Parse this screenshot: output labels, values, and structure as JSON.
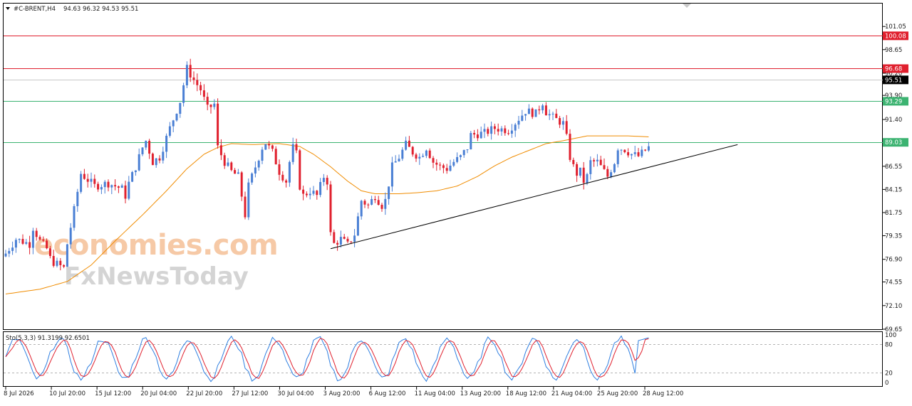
{
  "header": {
    "symbol": "#C-BRENT,H4",
    "ohlc": "94.63 96.32 94.53 95.51",
    "menu_icon": "triangle-down-icon"
  },
  "watermark": {
    "line1": "economies.com",
    "line2": "FxNewsToday"
  },
  "oscillator": {
    "label": "Sto(5,3,3) 91.3199 92.6501",
    "scale": [
      "100",
      "80",
      "20",
      "0"
    ]
  },
  "chart_data": {
    "type": "candlestick",
    "ylim": [
      69.65,
      103.5
    ],
    "y_ticks": [
      "101.05",
      "98.65",
      "96.20",
      "93.90",
      "91.40",
      "89.05",
      "86.55",
      "84.15",
      "81.75",
      "79.35",
      "76.90",
      "74.55",
      "72.10",
      "69.65"
    ],
    "x_tick_labels": [
      "8 Jul 2026",
      "10 Jul 20:00",
      "15 Jul 12:00",
      "20 Jul 04:00",
      "22 Jul 20:00",
      "27 Jul 12:00",
      "30 Jul 04:00",
      "3 Aug 20:00",
      "6 Aug 12:00",
      "11 Aug 04:00",
      "13 Aug 20:00",
      "18 Aug 12:00",
      "21 Aug 04:00",
      "25 Aug 20:00",
      "28 Aug 12:00"
    ],
    "bars": 189,
    "levels": [
      {
        "value": 100.08,
        "label": "100.08",
        "color": "#e0202e"
      },
      {
        "value": 96.68,
        "label": "96.68",
        "color": "#e0202e"
      },
      {
        "value": 95.51,
        "label": "95.51",
        "color": "#000000"
      },
      {
        "value": 93.29,
        "label": "93.29",
        "color": "#3cb371"
      },
      {
        "value": 89.03,
        "label": "89.03",
        "color": "#3cb371"
      }
    ],
    "trendline": {
      "from": {
        "bar": 95,
        "price": 78.0
      },
      "to": {
        "bar": 214,
        "price": 88.8
      }
    },
    "bull_color": "#4a7fd4",
    "bear_color": "#e0202e",
    "ma_color": "#f08c00",
    "close_path": [
      [
        0,
        77.5
      ],
      [
        3,
        79.0
      ],
      [
        7,
        78.5
      ],
      [
        8,
        80.2
      ],
      [
        10,
        78.8
      ],
      [
        12,
        78.0
      ],
      [
        13,
        77.0
      ],
      [
        14,
        76.6
      ],
      [
        17,
        76.0
      ],
      [
        18,
        78.5
      ],
      [
        20,
        82.0
      ],
      [
        22,
        85.8
      ],
      [
        26,
        84.5
      ],
      [
        30,
        84.8
      ],
      [
        34,
        84.2
      ],
      [
        35,
        83.5
      ],
      [
        36,
        84.8
      ],
      [
        38,
        86.5
      ],
      [
        40,
        88.5
      ],
      [
        41,
        89.2
      ],
      [
        43,
        87.0
      ],
      [
        45,
        87.5
      ],
      [
        48,
        90.5
      ],
      [
        51,
        93.3
      ],
      [
        53,
        96.7
      ],
      [
        55,
        95.5
      ],
      [
        57,
        94.5
      ],
      [
        59,
        92.5
      ],
      [
        61,
        93.0
      ],
      [
        62,
        88.5
      ],
      [
        64,
        87.0
      ],
      [
        66,
        86.0
      ],
      [
        68,
        85.5
      ],
      [
        70,
        81.5
      ],
      [
        71,
        84.5
      ],
      [
        73,
        86.5
      ],
      [
        75,
        88.5
      ],
      [
        76,
        89.0
      ],
      [
        78,
        88.0
      ],
      [
        80,
        86.0
      ],
      [
        82,
        85.0
      ],
      [
        83,
        87.0
      ],
      [
        84,
        88.5
      ],
      [
        85,
        87.8
      ],
      [
        86,
        84.5
      ],
      [
        87,
        83.5
      ],
      [
        89,
        84.0
      ],
      [
        91,
        83.5
      ],
      [
        93,
        85.5
      ],
      [
        94,
        85.0
      ],
      [
        95,
        79.5
      ],
      [
        96,
        78.5
      ],
      [
        98,
        79.0
      ],
      [
        100,
        78.4
      ],
      [
        102,
        79.5
      ],
      [
        104,
        83.0
      ],
      [
        106,
        82.5
      ],
      [
        108,
        83.5
      ],
      [
        110,
        82.5
      ],
      [
        111,
        83.0
      ],
      [
        113,
        86.5
      ],
      [
        115,
        87.5
      ],
      [
        117,
        88.8
      ],
      [
        119,
        88.0
      ],
      [
        121,
        87.5
      ],
      [
        123,
        88.5
      ],
      [
        125,
        87.0
      ],
      [
        127,
        86.5
      ],
      [
        129,
        86.3
      ],
      [
        131,
        87.0
      ],
      [
        133,
        87.5
      ],
      [
        135,
        88.5
      ],
      [
        136,
        89.8
      ],
      [
        140,
        90.0
      ],
      [
        143,
        90.5
      ],
      [
        147,
        90.3
      ],
      [
        150,
        91.5
      ],
      [
        152,
        92.3
      ],
      [
        155,
        92.0
      ],
      [
        157,
        93.2
      ],
      [
        158,
        92.2
      ],
      [
        160,
        91.6
      ],
      [
        163,
        91.0
      ],
      [
        164,
        89.5
      ],
      [
        165,
        87.5
      ],
      [
        166,
        86.5
      ],
      [
        167,
        85.8
      ],
      [
        168,
        86.0
      ],
      [
        169,
        85.0
      ],
      [
        170,
        85.5
      ],
      [
        171,
        87.0
      ],
      [
        173,
        87.0
      ],
      [
        175,
        86.0
      ],
      [
        176,
        85.5
      ],
      [
        178,
        87.0
      ],
      [
        179,
        88.5
      ],
      [
        181,
        88.3
      ],
      [
        183,
        87.8
      ],
      [
        185,
        87.6
      ],
      [
        187,
        88.2
      ],
      [
        189,
        88.8
      ],
      [
        190,
        90.0
      ],
      [
        191,
        91.0
      ],
      [
        193,
        90.2
      ],
      [
        194,
        90.8
      ],
      [
        196,
        91.8
      ],
      [
        197,
        93.5
      ],
      [
        198,
        94.5
      ],
      [
        199,
        95.5
      ]
    ],
    "ma_path": [
      [
        0,
        73.3
      ],
      [
        10,
        73.8
      ],
      [
        18,
        74.6
      ],
      [
        25,
        76.3
      ],
      [
        32,
        78.8
      ],
      [
        40,
        81.5
      ],
      [
        47,
        84.0
      ],
      [
        53,
        86.3
      ],
      [
        58,
        87.8
      ],
      [
        62,
        88.5
      ],
      [
        66,
        88.9
      ],
      [
        72,
        88.8
      ],
      [
        80,
        88.9
      ],
      [
        86,
        88.6
      ],
      [
        90,
        87.8
      ],
      [
        95,
        86.5
      ],
      [
        100,
        85.0
      ],
      [
        104,
        84.0
      ],
      [
        108,
        83.7
      ],
      [
        115,
        83.7
      ],
      [
        120,
        83.8
      ],
      [
        126,
        84.0
      ],
      [
        132,
        84.5
      ],
      [
        138,
        85.5
      ],
      [
        143,
        86.6
      ],
      [
        148,
        87.5
      ],
      [
        153,
        88.2
      ],
      [
        158,
        88.9
      ],
      [
        163,
        89.2
      ],
      [
        170,
        89.7
      ],
      [
        176,
        89.7
      ],
      [
        182,
        89.7
      ],
      [
        188,
        89.6
      ],
      [
        193,
        89.6
      ],
      [
        196,
        89.6
      ],
      [
        199,
        89.8
      ]
    ],
    "stochastic": {
      "period": "5,3,3",
      "main": 91.3199,
      "signal": 92.6501,
      "levels": [
        80,
        20
      ],
      "main_color": "#2f7fe0",
      "signal_color": "#e0202e"
    }
  }
}
